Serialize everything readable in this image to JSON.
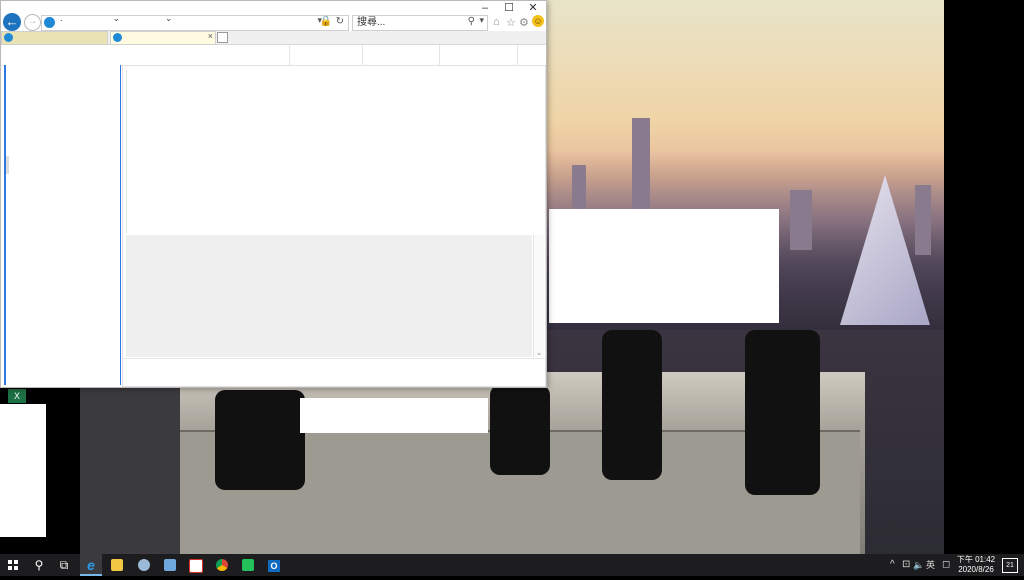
{
  "window": {
    "minimize": "–",
    "maximize": "☐",
    "close": "✕"
  },
  "nav": {
    "back_icon": "←",
    "forward_icon": "→",
    "address_value": ".                    ⌄                  ⌄",
    "lock_icon": "🔒",
    "refresh_icon": "↻",
    "dropdown_icon": "▾"
  },
  "search": {
    "placeholder": "搜尋...",
    "search_icon": "⚲",
    "dropdown_icon": "▾"
  },
  "tools": {
    "home_icon": "⌂",
    "favorites_icon": "☆",
    "settings_icon": "⚙",
    "feedback_icon": "☺"
  },
  "tabs": [
    {
      "label": ""
    },
    {
      "label": "",
      "close": "×"
    }
  ],
  "taskbar": {
    "search_icon": "⚲",
    "taskview_icon": "⧉",
    "apps": [
      {
        "name": "internet-explorer",
        "glyph": "e",
        "color": "#1e8ad6"
      },
      {
        "name": "file-explorer",
        "glyph": "",
        "color": "#f2c744"
      },
      {
        "name": "network-app",
        "glyph": "",
        "color": "#9ab9d6"
      },
      {
        "name": "notes-app",
        "glyph": "",
        "color": "#6fa8dc"
      },
      {
        "name": "acrobat",
        "glyph": "",
        "color": "#d9342b"
      },
      {
        "name": "chrome",
        "glyph": "",
        "color": "#e1b12c"
      },
      {
        "name": "line",
        "glyph": "",
        "color": "#22c159"
      },
      {
        "name": "outlook",
        "glyph": "O",
        "color": "#0f6ac2"
      }
    ],
    "tray": {
      "chevron": "^",
      "network_icon": "⊡",
      "volume_icon": "🔈",
      "ime": "英",
      "time": "下午 01:42",
      "date": "2020/8/26",
      "notification_count": "21"
    }
  }
}
